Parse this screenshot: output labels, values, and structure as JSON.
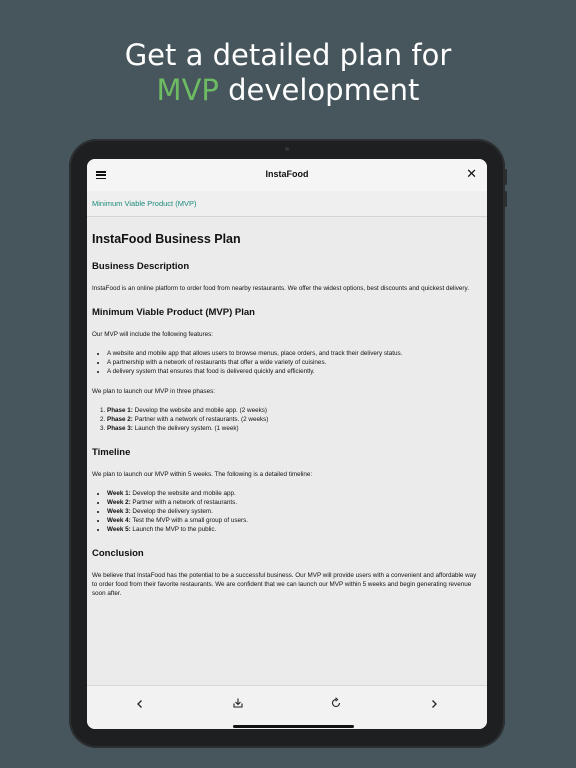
{
  "headline": {
    "line1": "Get a detailed plan for",
    "accent": "MVP",
    "line2_rest": " development"
  },
  "app": {
    "title": "InstaFood",
    "breadcrumb": "Minimum Viable Product (MVP)"
  },
  "doc": {
    "title": "InstaFood Business Plan",
    "business_heading": "Business Description",
    "business_text": "InstaFood is an online platform to order food from nearby restaurants. We offer the widest options, best discounts and quickest delivery.",
    "mvp_heading": "Minimum Viable Product (MVP) Plan",
    "mvp_intro": "Our MVP will include the following features:",
    "features": [
      "A website and mobile app that allows users to browse menus, place orders, and track their delivery status.",
      "A partnership with a network of restaurants that offer a wide variety of cuisines.",
      "A delivery system that ensures that food is delivered quickly and efficiently."
    ],
    "phases_intro": "We plan to launch our MVP in three phases:",
    "phases": [
      {
        "label": "Phase 1:",
        "text": " Develop the website and mobile app. (2 weeks)"
      },
      {
        "label": "Phase 2:",
        "text": " Partner with a network of restaurants. (2 weeks)"
      },
      {
        "label": "Phase 3:",
        "text": " Launch the delivery system. (1 week)"
      }
    ],
    "timeline_heading": "Timeline",
    "timeline_intro": "We plan to launch our MVP within 5 weeks. The following is a detailed timeline:",
    "weeks": [
      {
        "label": "Week 1:",
        "text": " Develop the website and mobile app."
      },
      {
        "label": "Week 2:",
        "text": " Partner with a network of restaurants."
      },
      {
        "label": "Week 3:",
        "text": " Develop the delivery system."
      },
      {
        "label": "Week 4:",
        "text": " Test the MVP with a small group of users."
      },
      {
        "label": "Week 5:",
        "text": " Launch the MVP to the public."
      }
    ],
    "conclusion_heading": "Conclusion",
    "conclusion_text": "We believe that InstaFood has the potential to be a successful business. Our MVP will provide users with a convenient and affordable way to order food from their favorite restaurants. We are confident that we can launch our MVP within 5 weeks and begin generating revenue soon after."
  },
  "icons": {
    "menu": "hamburger-icon",
    "close": "close-icon",
    "back": "chevron-left-icon",
    "download": "download-icon",
    "refresh": "refresh-icon",
    "forward": "chevron-right-icon"
  },
  "colors": {
    "background": "#46565c",
    "accent": "#6dbb63",
    "link": "#1d8a7d"
  }
}
